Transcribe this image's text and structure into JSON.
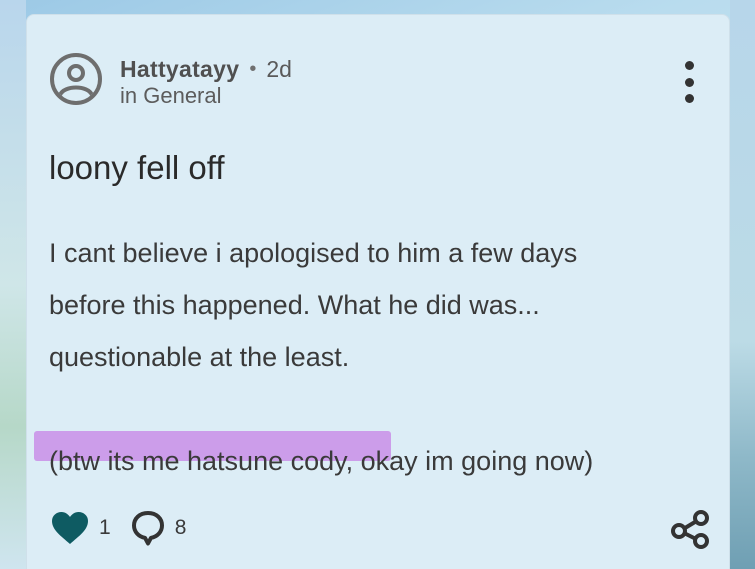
{
  "post": {
    "author": "Hattyatayy",
    "separator": "•",
    "age": "2d",
    "category": "in General",
    "title": "loony fell off",
    "body_lines": [
      "I cant believe i apologised to him a few days",
      "before this happened. What he did was...",
      "questionable at the least."
    ],
    "ps": "(btw its me hatsune cody, okay im going now)"
  },
  "actions": {
    "likes": "1",
    "comments": "8"
  },
  "icons": {
    "avatar": "avatar-icon",
    "menu": "more-vertical-icon",
    "like": "heart-icon",
    "comment": "comment-icon",
    "share": "share-icon"
  },
  "colors": {
    "card_background": "#dcedf6",
    "heart": "#0e5b62",
    "highlight": "#c98ee8"
  }
}
